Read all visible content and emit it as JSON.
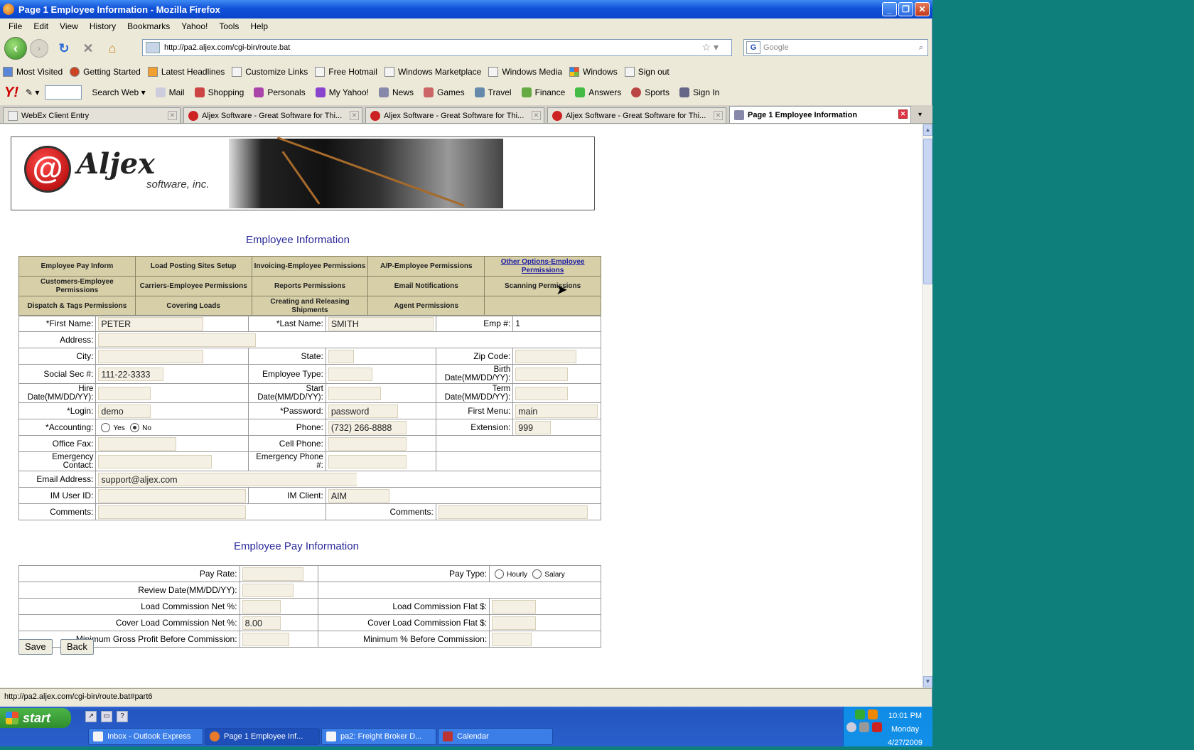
{
  "window": {
    "title": "Page 1 Employee Information - Mozilla Firefox"
  },
  "menu": [
    "File",
    "Edit",
    "View",
    "History",
    "Bookmarks",
    "Yahoo!",
    "Tools",
    "Help"
  ],
  "nav": {
    "url": "http://pa2.aljex.com/cgi-bin/route.bat",
    "search_placeholder": "Google"
  },
  "bookmarks": [
    "Most Visited",
    "Getting Started",
    "Latest Headlines",
    "Customize Links",
    "Free Hotmail",
    "Windows Marketplace",
    "Windows Media",
    "Windows",
    "Sign out"
  ],
  "yahoo": {
    "logo": "Y!",
    "search": "Search Web",
    "items": [
      "Mail",
      "Shopping",
      "Personals",
      "My Yahoo!",
      "News",
      "Games",
      "Travel",
      "Finance",
      "Answers",
      "Sports",
      "Sign In"
    ]
  },
  "tabs": [
    {
      "label": "WebEx Client Entry"
    },
    {
      "label": "Aljex Software - Great Software for Thi..."
    },
    {
      "label": "Aljex Software - Great Software for Thi..."
    },
    {
      "label": "Aljex Software - Great Software for Thi..."
    },
    {
      "label": "Page 1 Employee Information"
    }
  ],
  "banner": {
    "at": "@",
    "name": "Aljex",
    "sub": "software, inc."
  },
  "employee": {
    "title": "Employee Information",
    "permissions": [
      [
        "Employee Pay Inform",
        "Load Posting Sites Setup",
        "Invoicing-Employee Permissions",
        "A/P-Employee Permissions",
        "Other Options-Employee Permissions"
      ],
      [
        "Customers-Employee Permissions",
        "Carriers-Employee Permissions",
        "Reports Permissions",
        "Email Notifications",
        "Scanning Permissions"
      ],
      [
        "Dispatch & Tags Permissions",
        "Covering Loads",
        "Creating and Releasing Shipments",
        "Agent Permissions",
        ""
      ]
    ],
    "labels": {
      "first_name": "*First Name:",
      "last_name": "*Last Name:",
      "emp_no": "Emp #:",
      "address": "Address:",
      "city": "City:",
      "state": "State:",
      "zip": "Zip Code:",
      "ssn": "Social Sec #:",
      "emp_type": "Employee Type:",
      "birth": "Birth Date(MM/DD/YY):",
      "hire": "Hire Date(MM/DD/YY):",
      "start": "Start Date(MM/DD/YY):",
      "term": "Term Date(MM/DD/YY):",
      "login": "*Login:",
      "password": "*Password:",
      "first_menu": "First Menu:",
      "accounting": "*Accounting:",
      "yes": "Yes",
      "no": "No",
      "phone": "Phone:",
      "extension": "Extension:",
      "office_fax": "Office Fax:",
      "cell": "Cell Phone:",
      "emerg_contact": "Emergency Contact:",
      "emerg_phone": "Emergency Phone #:",
      "email": "Email Address:",
      "im_user": "IM User ID:",
      "im_client": "IM Client:",
      "comments": "Comments:",
      "comments2": "Comments:"
    },
    "values": {
      "first_name": "PETER",
      "last_name": "SMITH",
      "emp_no": "1",
      "ssn": "111-22-3333",
      "login": "demo",
      "password": "password",
      "first_menu": "main",
      "phone": "(732) 266-8888",
      "extension": "999",
      "email": "support@aljex.com",
      "im_client": "AIM",
      "accounting": "No"
    }
  },
  "pay": {
    "title": "Employee Pay Information",
    "labels": {
      "pay_rate": "Pay Rate:",
      "pay_type": "Pay Type:",
      "hourly": "Hourly",
      "salary": "Salary",
      "review": "Review Date(MM/DD/YY):",
      "lc_net": "Load Commission Net %:",
      "lc_flat": "Load Commission Flat $:",
      "clc_net": "Cover Load Commission Net %:",
      "clc_flat": "Cover Load Commission Flat $:",
      "min_gross": "Minimum Gross Profit Before Commission:",
      "min_pct": "Minimum % Before Commission:"
    },
    "values": {
      "clc_net": "8.00"
    }
  },
  "buttons": {
    "save": "Save",
    "back": "Back"
  },
  "status": "http://pa2.aljex.com/cgi-bin/route.bat#part6",
  "taskbar": {
    "start": "start",
    "tasks": [
      "Inbox - Outlook Express",
      "Page 1 Employee Inf...",
      "pa2: Freight Broker D...",
      "Calendar"
    ],
    "time": "10:01 PM",
    "day": "Monday",
    "date": "4/27/2009"
  }
}
